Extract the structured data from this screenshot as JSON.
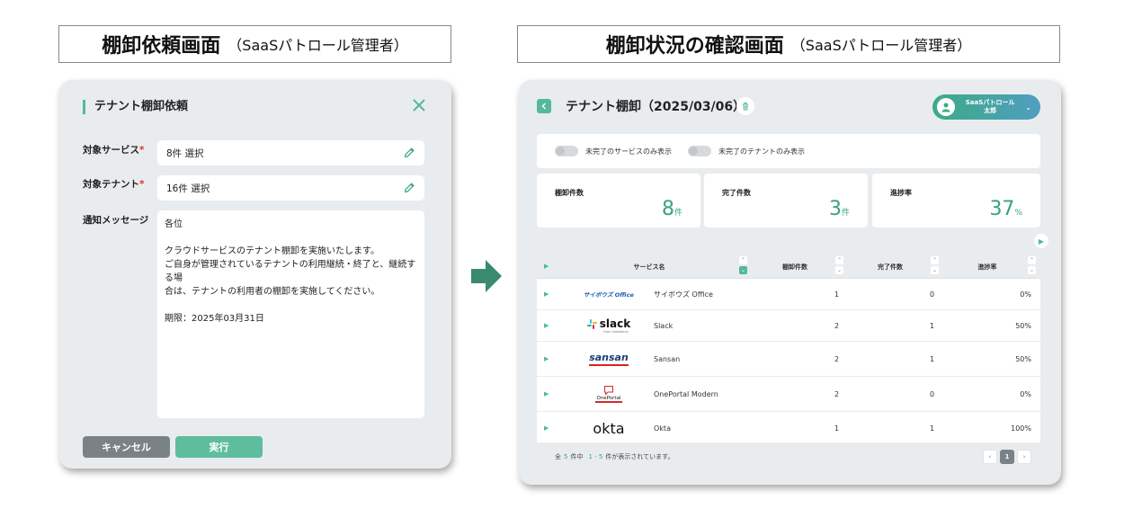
{
  "left_caption": {
    "main": "棚卸依頼画面",
    "sub": "（SaaSパトロール管理者）"
  },
  "right_caption": {
    "main": "棚卸状況の確認画面",
    "sub": "（SaaSパトロール管理者）"
  },
  "request_modal": {
    "title": "テナント棚卸依頼",
    "service_label": "対象サービス",
    "service_value": "8件 選択",
    "tenant_label": "対象テナント",
    "tenant_value": "16件 選択",
    "message_label": "通知メッセージ",
    "message_lines": [
      "各位",
      "",
      "クラウドサービスのテナント棚卸を実施いたします。",
      "ご自身が管理されているテナントの利用継続・終了と、継続する場",
      "合は、テナントの利用者の棚卸を実施してください。",
      "",
      "期限：2025年03月31日"
    ],
    "cancel_label": "キャンセル",
    "run_label": "実行",
    "required_mark": "*"
  },
  "status_panel": {
    "title": "テナント棚卸（2025/03/06）",
    "user_line1": "SaaSパトロール",
    "user_line2": "太郎",
    "toggle_services": "未完了のサービスのみ表示",
    "toggle_tenants": "未完了のテナントのみ表示",
    "stats": [
      {
        "label": "棚卸件数",
        "value": "8",
        "unit": "件"
      },
      {
        "label": "完了件数",
        "value": "3",
        "unit": "件"
      },
      {
        "label": "進捗率",
        "value": "37",
        "unit": "%"
      }
    ],
    "columns": [
      "サービス名",
      "棚卸件数",
      "完了件数",
      "進捗率"
    ],
    "rows": [
      {
        "logo": "サイボウズ Office",
        "name": "サイボウズ Office",
        "count": "1",
        "done": "0",
        "rate": "0%"
      },
      {
        "logo": "slack",
        "logo_sub": "from Salesforce",
        "name": "Slack",
        "count": "2",
        "done": "1",
        "rate": "50%"
      },
      {
        "logo": "sansan",
        "name": "Sansan",
        "count": "2",
        "done": "1",
        "rate": "50%"
      },
      {
        "logo": "OnePortal",
        "name": "OnePortal Modern",
        "count": "2",
        "done": "0",
        "rate": "0%"
      },
      {
        "logo": "okta",
        "name": "Okta",
        "count": "1",
        "done": "1",
        "rate": "100%"
      }
    ],
    "footer": {
      "prefix": "全",
      "total": "5",
      "mid": "件中",
      "range": "1 - 5",
      "suffix": "件が表示されています。"
    },
    "pager": {
      "prev": "‹",
      "current": "1",
      "next": "›"
    }
  },
  "colors": {
    "accent": "#53b99a",
    "panel_bg": "#e9ecee",
    "cancel": "#7a8288"
  }
}
